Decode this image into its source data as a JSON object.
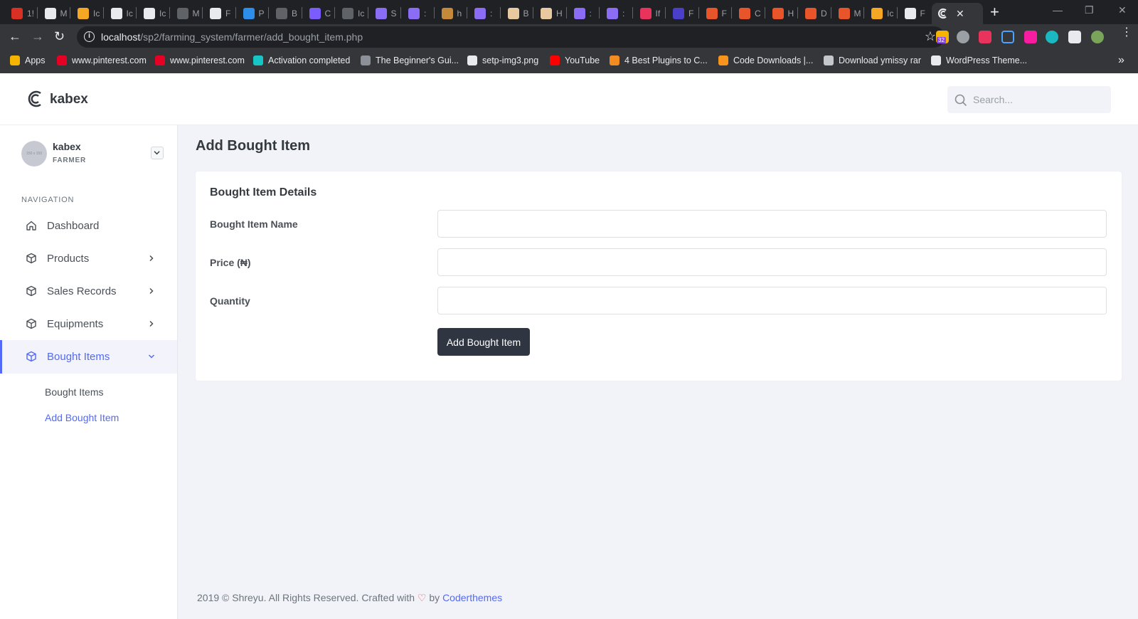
{
  "browser": {
    "tab_titles": [
      "1!",
      "M",
      "Ic",
      "Ic",
      "Ic",
      "M",
      "F",
      "P",
      "B",
      "C",
      "Ic",
      "S",
      ":",
      "h",
      ":",
      "B",
      "H",
      ":",
      ":",
      "If",
      "F",
      "F",
      "C",
      "H",
      "D",
      "M",
      "Ic",
      "F",
      "C"
    ],
    "url_host": "localhost",
    "url_path": "/sp2/farming_system/farmer/add_bought_item.php",
    "extension_badge": "32",
    "bookmarks": [
      {
        "label": "Apps",
        "icon": "apps-grid-icon",
        "color": "#f4b400"
      },
      {
        "label": "www.pinterest.com",
        "icon": "pinterest-icon",
        "color": "#e60023"
      },
      {
        "label": "www.pinterest.com",
        "icon": "pinterest-icon",
        "color": "#e60023"
      },
      {
        "label": "Activation completed",
        "icon": "activation-icon",
        "color": "#18c5c5"
      },
      {
        "label": "The Beginner's Gui...",
        "icon": "guide-icon",
        "color": "#8b9099"
      },
      {
        "label": "setp-img3.png",
        "icon": "globe-icon",
        "color": "#e8eaed"
      },
      {
        "label": "YouTube",
        "icon": "youtube-icon",
        "color": "#ff0000"
      },
      {
        "label": "4 Best Plugins to C...",
        "icon": "plugin-icon",
        "color": "#f28b20"
      },
      {
        "label": "Code Downloads |...",
        "icon": "code-icon",
        "color": "#f7941d"
      },
      {
        "label": "Download ymissy rar",
        "icon": "download-icon",
        "color": "#c4c7cc"
      },
      {
        "label": "WordPress Theme...",
        "icon": "page-icon",
        "color": "#e8eaed"
      }
    ]
  },
  "app": {
    "brand": "kabex",
    "search_placeholder": "Search...",
    "user": {
      "name": "kabex",
      "role": "FARMER",
      "avatar_text": "150 x 150"
    },
    "nav_title": "NAVIGATION",
    "nav_items": [
      {
        "label": "Dashboard",
        "icon": "home-icon",
        "has_children": false,
        "active": false
      },
      {
        "label": "Products",
        "icon": "package-icon",
        "has_children": true,
        "active": false
      },
      {
        "label": "Sales Records",
        "icon": "package-icon",
        "has_children": true,
        "active": false
      },
      {
        "label": "Equipments",
        "icon": "package-icon",
        "has_children": true,
        "active": false
      },
      {
        "label": "Bought Items",
        "icon": "package-icon",
        "has_children": true,
        "active": true
      }
    ],
    "sub_items": [
      {
        "label": "Bought Items",
        "active": false
      },
      {
        "label": "Add Bought Item",
        "active": true
      }
    ],
    "page_title": "Add Bought Item",
    "form": {
      "card_title": "Bought Item Details",
      "fields": [
        {
          "label": "Bought Item Name",
          "value": ""
        },
        {
          "label": "Price (₦)",
          "value": ""
        },
        {
          "label": "Quantity",
          "value": ""
        }
      ],
      "submit_label": "Add Bought Item"
    },
    "footer": {
      "prefix": "2019 © Shreyu. All Rights Reserved. Crafted with",
      "heart": "♡",
      "by": "by",
      "link": "Coderthemes"
    },
    "colors": {
      "accent": "#5369f8",
      "button": "#2f3641",
      "background": "#f2f3f8"
    }
  }
}
